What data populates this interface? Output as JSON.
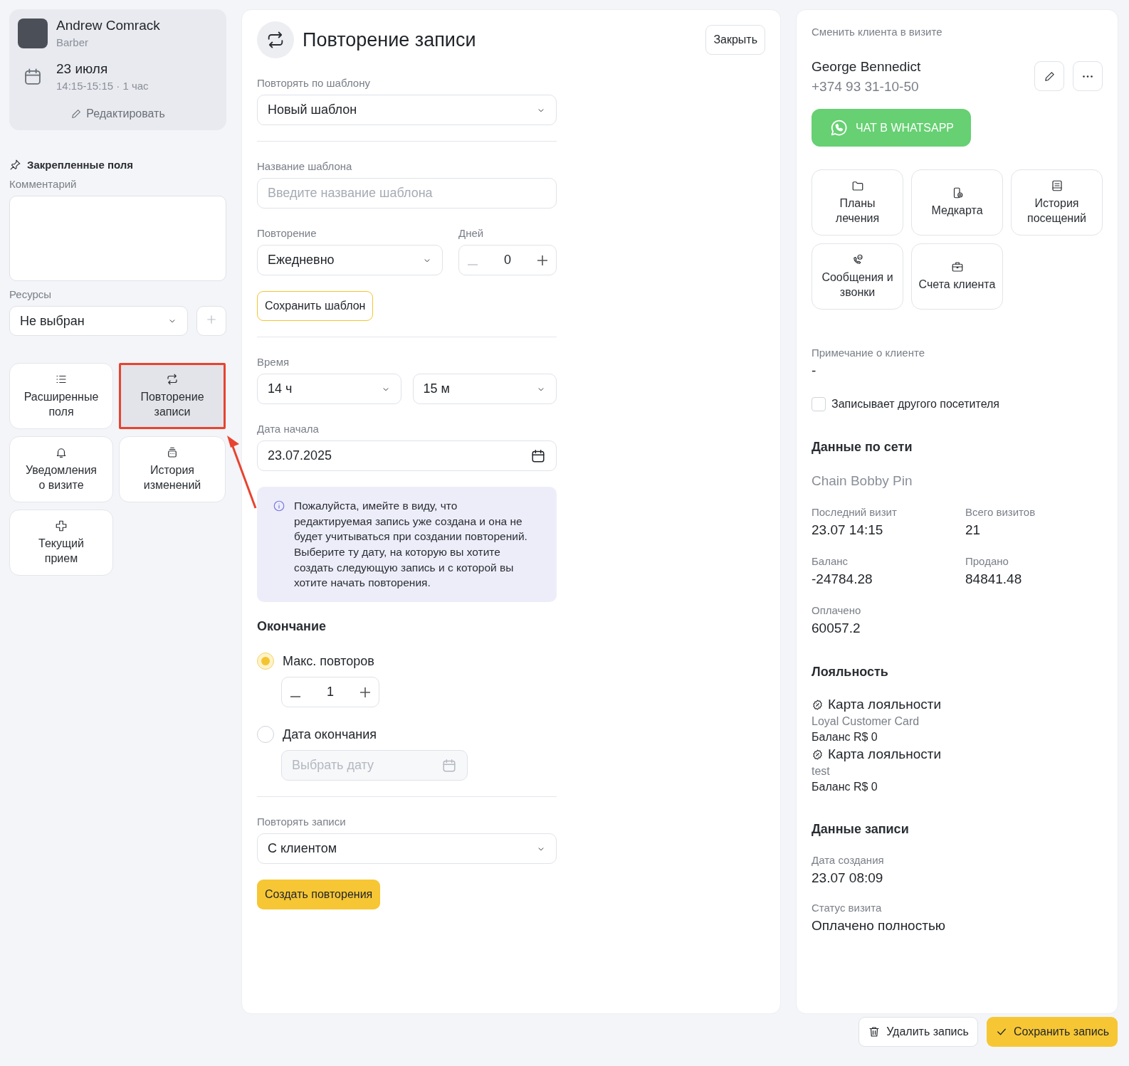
{
  "staff": {
    "name": "Andrew Comrack",
    "role": "Barber",
    "date": "23 июля",
    "time": "14:15-15:15 · 1 час",
    "edit": "Редактировать"
  },
  "pinned": {
    "title": "Закрепленные поля",
    "comment_label": "Комментарий",
    "resources_label": "Ресурсы",
    "resources_value": "Не выбран"
  },
  "tiles": [
    {
      "label": "Расширенные поля",
      "selected": false
    },
    {
      "label": "Повторение записи",
      "selected": true
    },
    {
      "label": "Уведомления о визите",
      "selected": false
    },
    {
      "label": "История изменений",
      "selected": false
    },
    {
      "label": "Текущий прием",
      "selected": false
    }
  ],
  "panel": {
    "title": "Повторение записи",
    "close": "Закрыть",
    "template_label": "Повторять по шаблону",
    "template_value": "Новый шаблон",
    "name_label": "Название шаблона",
    "name_placeholder": "Введите название шаблона",
    "repeat_label": "Повторение",
    "repeat_value": "Ежедневно",
    "days_label": "Дней",
    "days_value": "0",
    "save_template": "Сохранить шаблон",
    "time_label": "Время",
    "hours": "14 ч",
    "minutes": "15 м",
    "start_label": "Дата начала",
    "start_value": "23.07.2025",
    "notice": "Пожалуйста, имейте в виду, что редактируемая запись уже создана и она не будет учитываться при создании повторений. Выберите ту дату, на которую вы хотите создать следующую запись и с которой вы хотите начать повторения.",
    "end_title": "Окончание",
    "end_options": [
      {
        "kind": "count",
        "label": "Макс. повторов",
        "selected": true,
        "value": "1"
      },
      {
        "kind": "date",
        "label": "Дата окончания",
        "selected": false,
        "placeholder": "Выбрать дату"
      }
    ],
    "repeat_with_label": "Повторять записи",
    "repeat_with_value": "С клиентом",
    "create": "Создать повторения"
  },
  "client": {
    "change": "Сменить клиента в визите",
    "name": "George Bennedict",
    "phone": "+374 93 31-10-50",
    "whatsapp": "ЧАТ В WHATSAPP",
    "actions": [
      {
        "label": "Планы лечения"
      },
      {
        "label": "Медкарта"
      },
      {
        "label": "История посещений"
      },
      {
        "label": "Сообщения и звонки"
      },
      {
        "label": "Счета клиента"
      }
    ],
    "note_label": "Примечание о клиенте",
    "note_value": "-",
    "other_visitor": {
      "label": "Записывает другого посетителя",
      "checked": false
    },
    "network_title": "Данные по сети",
    "network_name": "Chain Bobby Pin",
    "stats": [
      {
        "label": "Последний визит",
        "value": "23.07 14:15"
      },
      {
        "label": "Всего визитов",
        "value": "21"
      },
      {
        "label": "Баланс",
        "value": "-24784.28"
      },
      {
        "label": "Продано",
        "value": "84841.48"
      },
      {
        "label": "Оплачено",
        "value": "60057.2"
      }
    ],
    "loyalty_title": "Лояльность",
    "cards": [
      {
        "title": "Карта лояльности",
        "name": "Loyal Customer Card",
        "balance": "Баланс R$ 0"
      },
      {
        "title": "Карта лояльности",
        "name": "test",
        "balance": "Баланс R$ 0"
      }
    ],
    "record_title": "Данные записи",
    "record": [
      {
        "label": "Дата создания",
        "value": "23.07 08:09"
      },
      {
        "label": "Статус визита",
        "value": "Оплачено полностью"
      }
    ]
  },
  "footer": {
    "delete": "Удалить запись",
    "save": "Сохранить запись"
  }
}
